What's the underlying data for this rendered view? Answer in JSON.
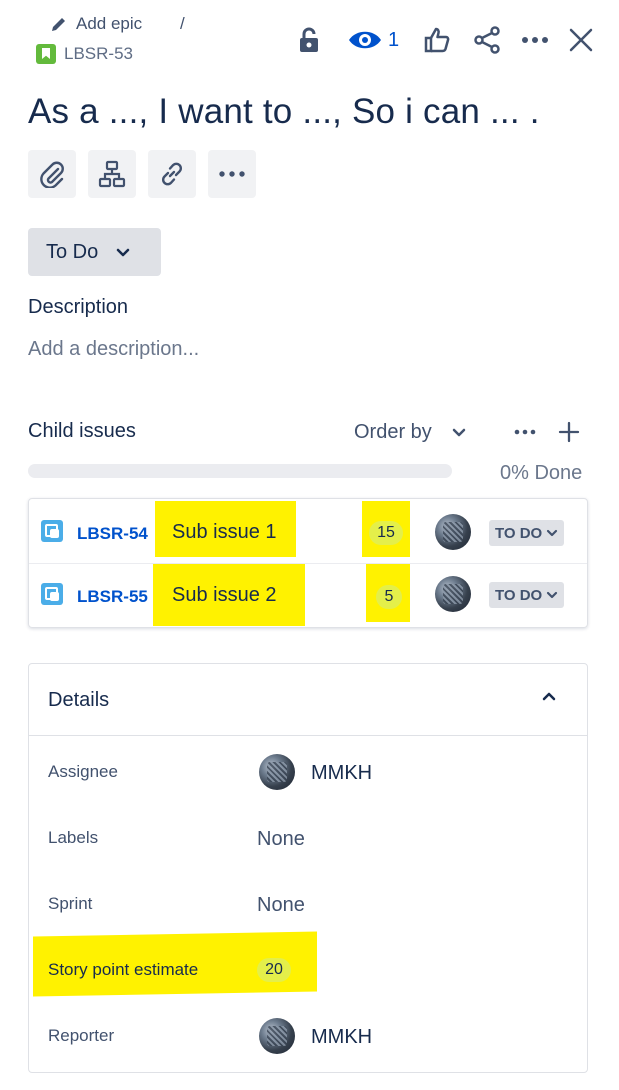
{
  "breadcrumb": {
    "add_epic": "Add epic",
    "separator": "/",
    "issue_key": "LBSR-53"
  },
  "toolbar": {
    "watchers_count": "1",
    "icons": [
      "lock-icon",
      "eye-icon",
      "thumbs-up-icon",
      "share-icon",
      "more-icon",
      "close-icon"
    ]
  },
  "issue": {
    "title": "As a ..., I want to ..., So i can ... .",
    "status": "To Do"
  },
  "description": {
    "label": "Description",
    "placeholder": "Add a description..."
  },
  "child_issues": {
    "label": "Child issues",
    "order_by": "Order by",
    "progress_text": "0% Done",
    "progress_fraction": 0,
    "items": [
      {
        "key": "LBSR-54",
        "summary": "Sub issue 1",
        "points": "15",
        "status": "TO DO"
      },
      {
        "key": "LBSR-55",
        "summary": "Sub issue 2",
        "points": "5",
        "status": "TO DO"
      }
    ]
  },
  "details": {
    "title": "Details",
    "fields": {
      "assignee_label": "Assignee",
      "assignee_value": "MMKH",
      "labels_label": "Labels",
      "labels_value": "None",
      "sprint_label": "Sprint",
      "sprint_value": "None",
      "story_points_label": "Story point estimate",
      "story_points_value": "20",
      "reporter_label": "Reporter",
      "reporter_value": "MMKH"
    }
  },
  "colors": {
    "link": "#0052cc",
    "highlight": "#fff200",
    "story": "#63ba3c",
    "subtask": "#4bade8"
  }
}
